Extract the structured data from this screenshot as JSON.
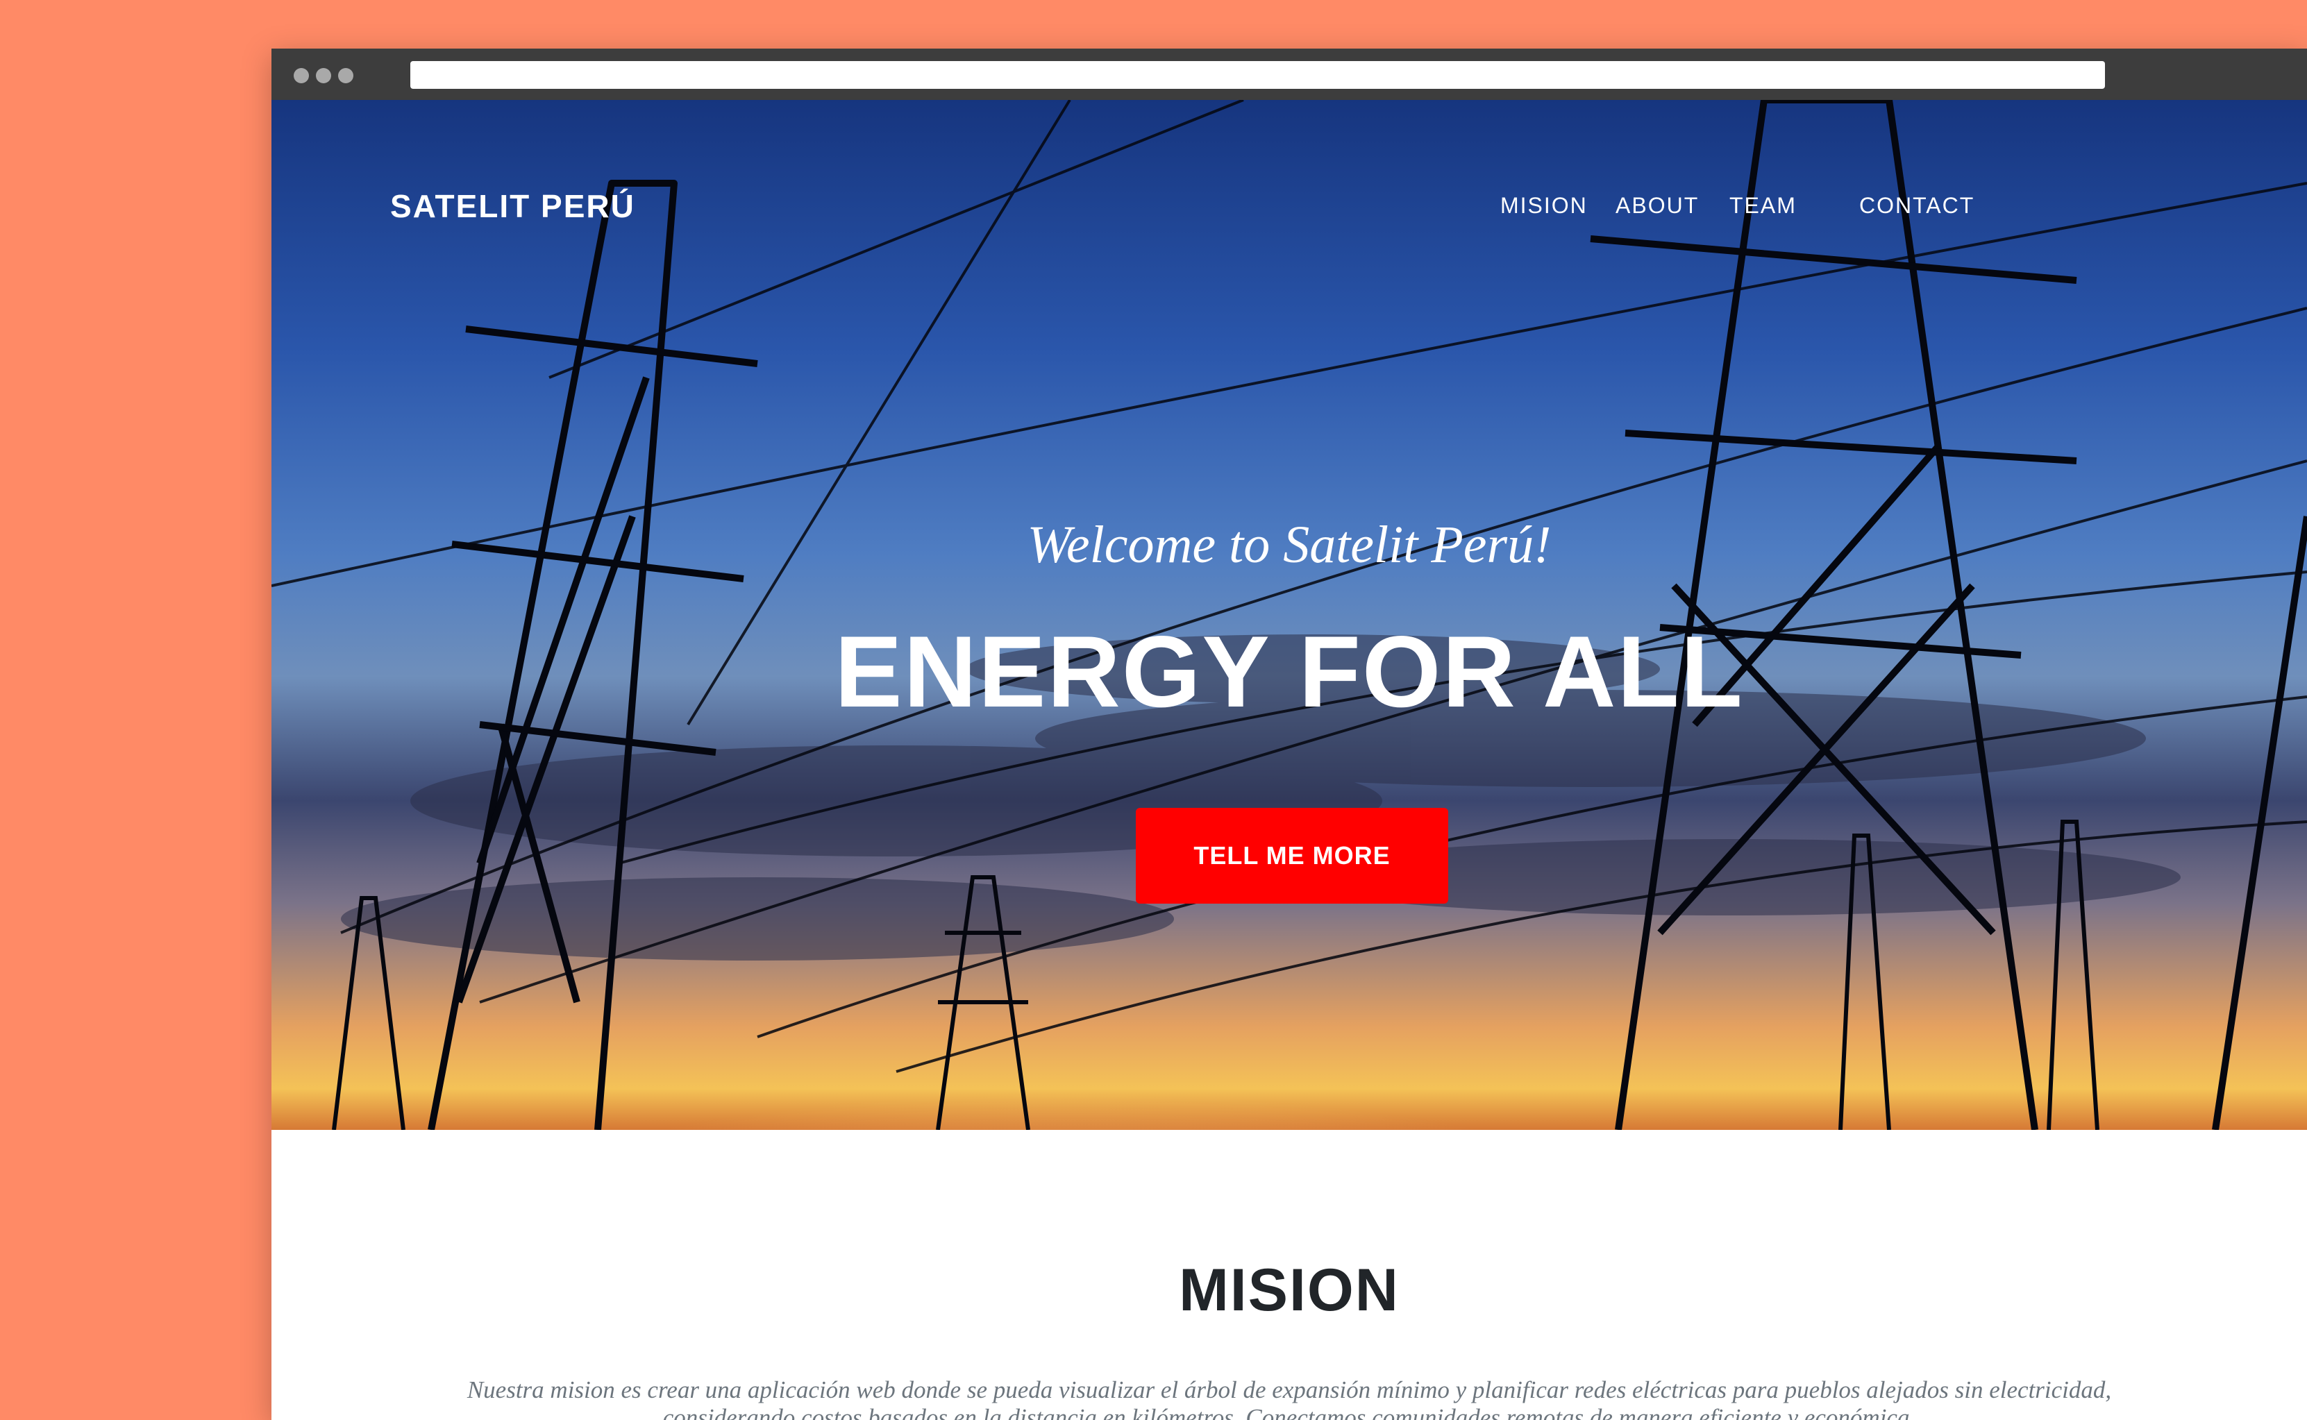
{
  "brand": "SATELIT PERÚ",
  "nav": {
    "items": [
      {
        "label": "MISION"
      },
      {
        "label": "ABOUT"
      },
      {
        "label": "TEAM"
      },
      {
        "label": "CONTACT"
      }
    ]
  },
  "hero": {
    "subheading": "Welcome to Satelit Perú!",
    "heading": "ENERGY FOR ALL",
    "button_label": "TELL ME MORE"
  },
  "mision": {
    "title": "MISION",
    "text": "Nuestra mision es crear una aplicación web donde se pueda visualizar el árbol de expansión mínimo y planificar redes eléctricas para pueblos alejados sin electricidad, considerando costos basados en la distancia en kilómetros. Conectamos comunidades remotas de manera eficiente y económica."
  },
  "colors": {
    "page_background": "#FF8A66",
    "accent": "#FF0000",
    "browser_chrome": "#3D3D3D"
  }
}
